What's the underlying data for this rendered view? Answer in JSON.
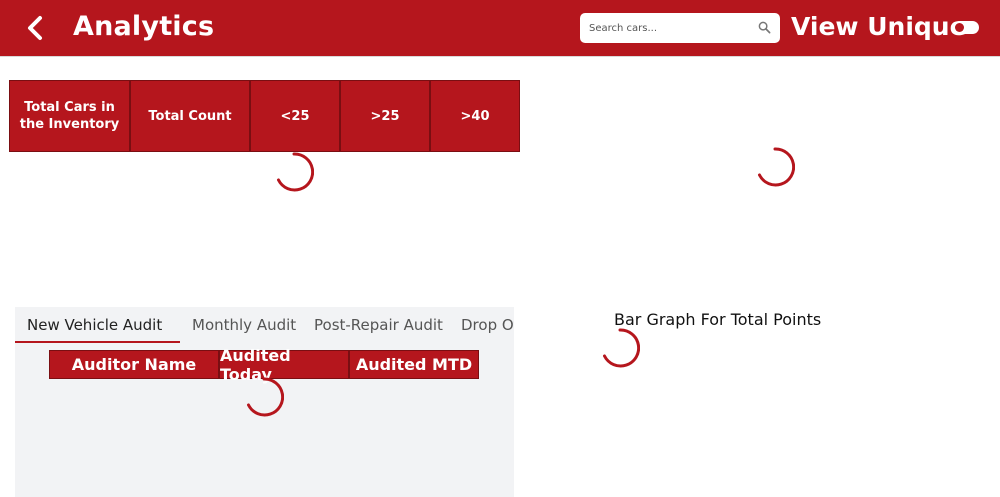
{
  "header": {
    "title": "Analytics",
    "search_placeholder": "Search cars...",
    "view_unique_label": "View Unique"
  },
  "inventory_table": {
    "headers": [
      "Total Cars in the Inventory",
      "Total Count",
      "<25",
      ">25",
      ">40"
    ]
  },
  "audit": {
    "tabs": [
      "New Vehicle Audit",
      "Monthly Audit",
      "Post-Repair Audit",
      "Drop Off"
    ],
    "active_tab": "New Vehicle Audit",
    "columns": [
      "Auditor Name",
      "Audited Today",
      "Audited MTD"
    ]
  },
  "bar_graph": {
    "title": "Bar Graph For Total Points"
  },
  "colors": {
    "brand": "#b5161d",
    "panel_bg": "#f2f3f5"
  },
  "icons": [
    "back-arrow-icon",
    "search-icon",
    "toggle-switch",
    "loading-spinner-icon"
  ]
}
